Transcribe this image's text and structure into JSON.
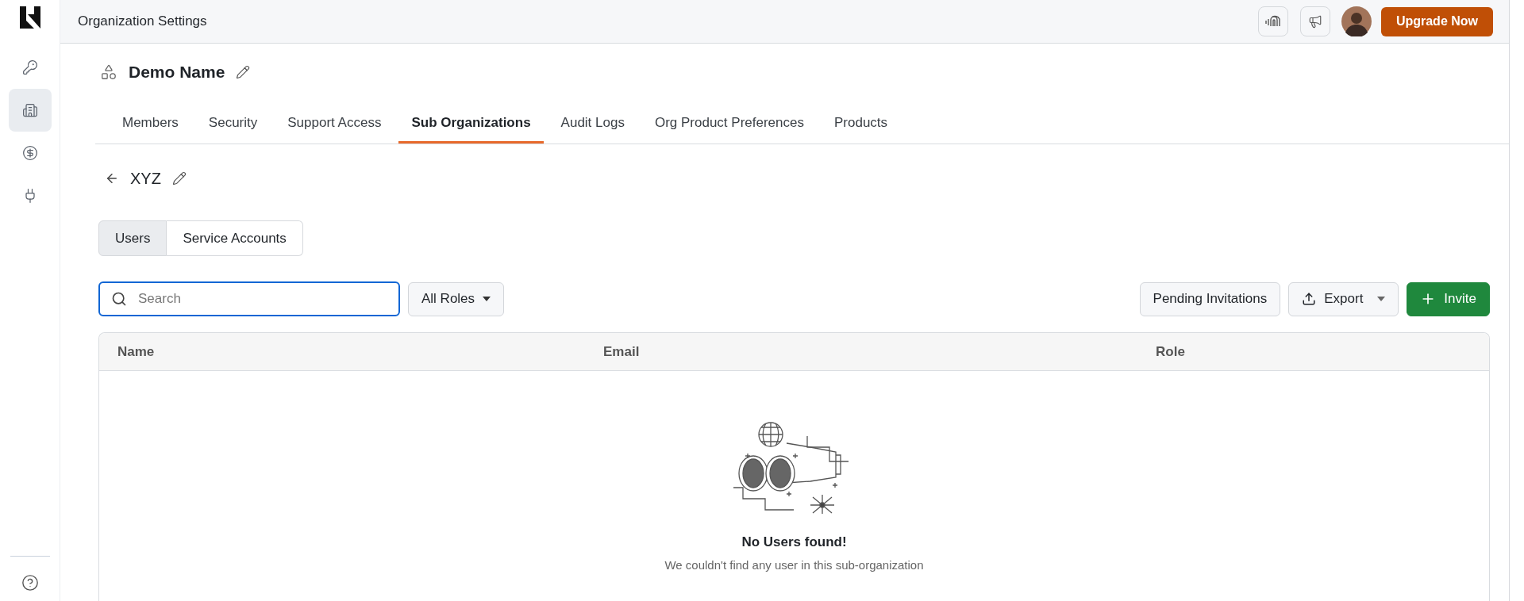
{
  "header": {
    "title": "Organization Settings",
    "upgrade_button": "Upgrade Now"
  },
  "sidebar": {
    "items": [
      {
        "kind": "key",
        "selected": false
      },
      {
        "kind": "building",
        "selected": true
      },
      {
        "kind": "dollar",
        "selected": false
      },
      {
        "kind": "plug",
        "selected": false
      }
    ]
  },
  "org": {
    "name": "Demo Name"
  },
  "tabs": [
    {
      "label": "Members",
      "selected": false
    },
    {
      "label": "Security",
      "selected": false
    },
    {
      "label": "Support Access",
      "selected": false
    },
    {
      "label": "Sub Organizations",
      "selected": true
    },
    {
      "label": "Audit Logs",
      "selected": false
    },
    {
      "label": "Org Product Preferences",
      "selected": false
    },
    {
      "label": "Products",
      "selected": false
    }
  ],
  "sub_org": {
    "name": "XYZ"
  },
  "segments": [
    {
      "label": "Users",
      "selected": true
    },
    {
      "label": "Service Accounts",
      "selected": false
    }
  ],
  "search": {
    "placeholder": "Search"
  },
  "role_filter": "All Roles",
  "actions": {
    "pending": "Pending Invitations",
    "export": "Export",
    "invite": "Invite"
  },
  "table": {
    "columns": [
      "Name",
      "Email",
      "Role"
    ],
    "empty": {
      "title": "No Users found!",
      "message": "We couldn't find any user in this sub-organization"
    }
  }
}
